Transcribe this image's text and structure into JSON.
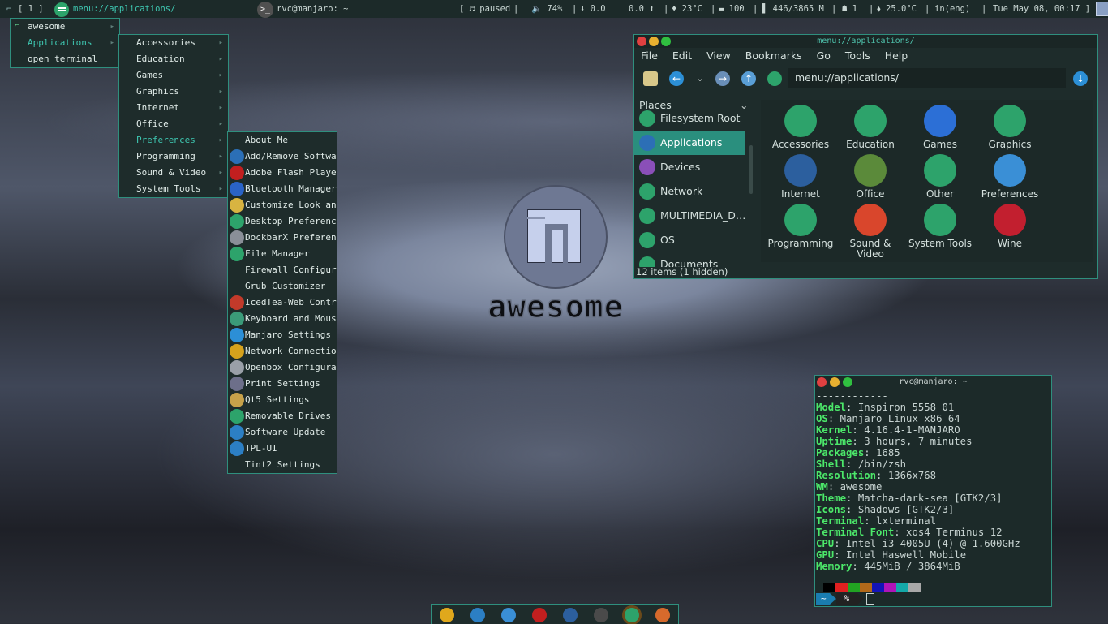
{
  "topbar": {
    "tags": "[ 1 ]",
    "launcher_url": "menu://applications/",
    "task_title": "rvc@manjaro: ~",
    "music": "[ ♬ paused",
    "volume": "🔈 74%",
    "net_down": "⬇ 0.0",
    "net_up": "0.0 ⬆",
    "temp1": "♦ 23°C",
    "battery": "▬ 100",
    "mem": "▌ 446/3865 M",
    "cpu_count": "☗ 1",
    "temp2": "⬧ 25.0°C",
    "kbd": "in(eng)",
    "clock": "Tue May 08, 00:17 ]"
  },
  "main_menu": {
    "items": [
      {
        "label": "awesome"
      },
      {
        "label": "Applications"
      },
      {
        "label": "open terminal"
      }
    ]
  },
  "apps_menu": {
    "items": [
      {
        "label": "Accessories"
      },
      {
        "label": "Education"
      },
      {
        "label": "Games"
      },
      {
        "label": "Graphics"
      },
      {
        "label": "Internet"
      },
      {
        "label": "Office"
      },
      {
        "label": "Preferences"
      },
      {
        "label": "Programming"
      },
      {
        "label": "Sound & Video"
      },
      {
        "label": "System Tools"
      }
    ]
  },
  "prefs_menu": {
    "items": [
      {
        "label": "About Me",
        "color": ""
      },
      {
        "label": "Add/Remove Softwa…",
        "color": "#2b6fb6"
      },
      {
        "label": "Adobe Flash Player",
        "color": "#c21f1f"
      },
      {
        "label": "Bluetooth Manager",
        "color": "#2a63c7"
      },
      {
        "label": "Customize Look an…",
        "color": "#d8b441"
      },
      {
        "label": "Desktop Preferenc…",
        "color": "#2da36b"
      },
      {
        "label": "DockbarX Preferen…",
        "color": "#8a8f98"
      },
      {
        "label": "File Manager",
        "color": "#2da36b"
      },
      {
        "label": "Firewall Configur…",
        "color": ""
      },
      {
        "label": "Grub Customizer",
        "color": ""
      },
      {
        "label": "IcedTea-Web Contr…",
        "color": "#c23a2a"
      },
      {
        "label": "Keyboard and Mouse",
        "color": "#3b9b79"
      },
      {
        "label": "Manjaro Settings …",
        "color": "#2c8fd6"
      },
      {
        "label": "Network Connectio…",
        "color": "#d6a21c"
      },
      {
        "label": "Openbox Configura…",
        "color": "#9aa0a8"
      },
      {
        "label": "Print Settings",
        "color": "#6d6f8a"
      },
      {
        "label": "Qt5 Settings",
        "color": "#c7a24a"
      },
      {
        "label": "Removable Drives …",
        "color": "#2da36b"
      },
      {
        "label": "Software Update",
        "color": "#2c7fc4"
      },
      {
        "label": "TPL-UI",
        "color": "#2c7fc4"
      },
      {
        "label": "Tint2 Settings",
        "color": ""
      }
    ]
  },
  "file_manager": {
    "title": "menu://applications/",
    "menubar": [
      "File",
      "Edit",
      "View",
      "Bookmarks",
      "Go",
      "Tools",
      "Help"
    ],
    "address": "menu://applications/",
    "places_header": "Places",
    "places": [
      {
        "label": "Filesystem Root",
        "color": "#2da36b"
      },
      {
        "label": "Applications",
        "color": "#2c6fb6"
      },
      {
        "label": "Devices",
        "color": "#8a4fb8"
      },
      {
        "label": "Network",
        "color": "#2da36b"
      },
      {
        "label": "MULTIMEDIA_D…",
        "color": "#2da36b"
      },
      {
        "label": "OS",
        "color": "#2da36b"
      },
      {
        "label": "Documents",
        "color": "#2da36b"
      }
    ],
    "grid": [
      {
        "label": "Accessories",
        "color": "#2da36b"
      },
      {
        "label": "Education",
        "color": "#2da36b"
      },
      {
        "label": "Games",
        "color": "#2c6fd6"
      },
      {
        "label": "Graphics",
        "color": "#2da36b"
      },
      {
        "label": "Internet",
        "color": "#2c5f9e"
      },
      {
        "label": "Office",
        "color": "#5b8a3a"
      },
      {
        "label": "Other",
        "color": "#2da36b"
      },
      {
        "label": "Preferences",
        "color": "#3a8fd6"
      },
      {
        "label": "Programming",
        "color": "#2da36b"
      },
      {
        "label": "Sound & Video",
        "color": "#d9462c"
      },
      {
        "label": "System Tools",
        "color": "#2da36b"
      },
      {
        "label": "Wine",
        "color": "#c21f2f"
      }
    ],
    "status": "12 items (1 hidden)"
  },
  "terminal": {
    "title": "rvc@manjaro: ~",
    "dashes": "------------",
    "lines": [
      {
        "k": "Model",
        "v": ": Inspiron 5558 01"
      },
      {
        "k": "OS",
        "v": ": Manjaro Linux x86_64"
      },
      {
        "k": "Kernel",
        "v": ": 4.16.4-1-MANJARO"
      },
      {
        "k": "Uptime",
        "v": ": 3 hours, 7 minutes"
      },
      {
        "k": "Packages",
        "v": ": 1685"
      },
      {
        "k": "Shell",
        "v": ": /bin/zsh"
      },
      {
        "k": "Resolution",
        "v": ": 1366x768"
      },
      {
        "k": "WM",
        "v": ": awesome"
      },
      {
        "k": "Theme",
        "v": ": Matcha-dark-sea [GTK2/3]"
      },
      {
        "k": "Icons",
        "v": ": Shadows [GTK2/3]"
      },
      {
        "k": "Terminal",
        "v": ": lxterminal"
      },
      {
        "k": "Terminal Font",
        "v": ": xos4 Terminus 12"
      },
      {
        "k": "CPU",
        "v": ": Intel i3-4005U (4) @ 1.600GHz"
      },
      {
        "k": "GPU",
        "v": ": Intel Haswell Mobile"
      },
      {
        "k": "Memory",
        "v": ": 445MiB / 3864MiB"
      }
    ],
    "colors": [
      "#000000",
      "#e02020",
      "#22a322",
      "#b2691a",
      "#1414b8",
      "#b014b8",
      "#14a8a8",
      "#a8a8a8"
    ],
    "prompt_dir": "~",
    "prompt_sym": "%"
  },
  "desktop": {
    "logo_text": "awesome"
  },
  "dock": {
    "apps": [
      {
        "name": "chrome-icon",
        "color": "#e0a81c"
      },
      {
        "name": "network-icon",
        "color": "#2c7fc4"
      },
      {
        "name": "manjaro-icon",
        "color": "#3a8fd6"
      },
      {
        "name": "terminal-red-icon",
        "color": "#c21f1f"
      },
      {
        "name": "settings-icon",
        "color": "#2c5f9e"
      },
      {
        "name": "terminal-icon",
        "color": "#4a4a4a"
      },
      {
        "name": "file-manager-icon",
        "color": "#2da36b"
      },
      {
        "name": "firefox-icon",
        "color": "#d66a2c"
      }
    ]
  }
}
